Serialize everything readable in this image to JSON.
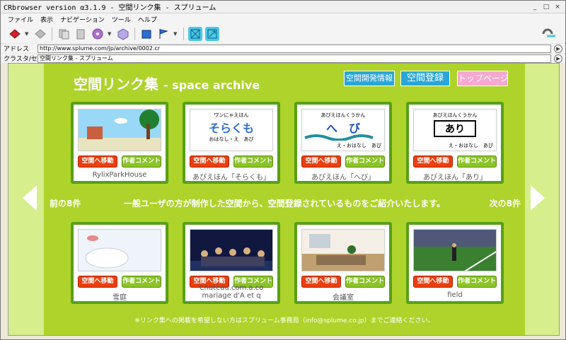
{
  "window": {
    "title": "CRbrowser version α3.1.9 - 空間リンク集 - スプリューム",
    "buttons": [
      "_",
      "□",
      "×"
    ]
  },
  "menu": [
    "ファイル",
    "表示",
    "ナビゲーション",
    "ツール",
    "ヘルプ"
  ],
  "toolbar": {
    "icons": [
      "back-icon",
      "forward-icon",
      "copy-icon",
      "paste-icon",
      "cd-icon",
      "cube-icon",
      "book-icon",
      "flag-icon",
      "grid-icon",
      "transform-icon"
    ]
  },
  "address": {
    "label": "アドレス",
    "value": "http://www.splume.com/jp/archive/0002.cr"
  },
  "cluster": {
    "label": "クラスタ/セル",
    "value": "空間リンク集 - スプリューム"
  },
  "page": {
    "title_main": "空間リンク集",
    "title_sub": "- space archive",
    "btn_info": "空間開発情報",
    "btn_register": "空間登録",
    "btn_top": "トップページ",
    "prev": "前の8件",
    "next": "次の8件",
    "intro": "一般ユーザの方が制作した空間から、空間登録されているものをご紹介いたします。",
    "footer": "※リンク集への掲載を希望しない方はスプリューム事務局（info@splume.co.jp）までご連絡ください。",
    "go_label": "空間へ移動",
    "comment_label": "作者コメント",
    "cards": [
      {
        "title": "RylixParkHouse"
      },
      {
        "title": "あぴえほん「そらくも」",
        "thumb_small": "ワンにゃえほん",
        "thumb_big": "そらくも",
        "thumb_foot": "おはなし・え　あぴ"
      },
      {
        "title": "あぴえほん「へび」",
        "thumb_small": "あぴえほんくうかん",
        "thumb_big": "へ　び",
        "thumb_foot": "え・おはなし　あぴ"
      },
      {
        "title": "あぴえほん「あり」",
        "thumb_small": "あぴえほんくうかん",
        "thumb_big": "あり",
        "thumb_foot": "え・おはなし　あぴ"
      },
      {
        "title": "雪庭"
      },
      {
        "title": "Chateau.com.a.co mariage d'A et q"
      },
      {
        "title": "会議室"
      },
      {
        "title": "field"
      }
    ]
  }
}
